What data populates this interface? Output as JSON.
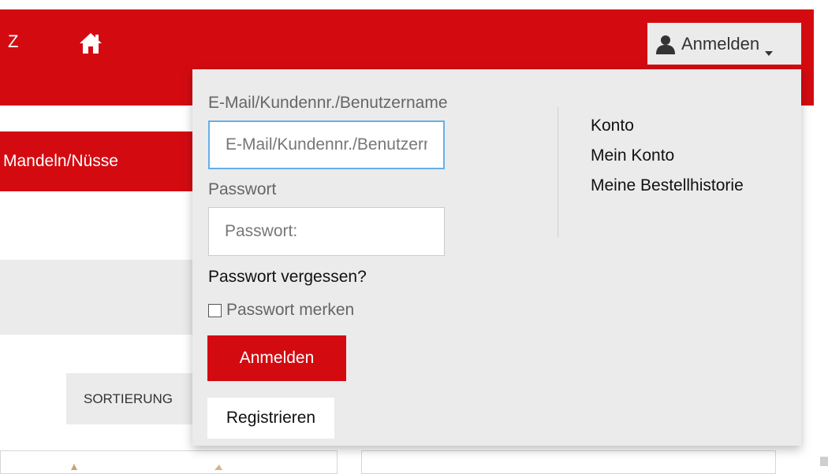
{
  "header": {
    "nav_partial": "Z",
    "home_icon": "home-icon",
    "login_button_label": "Anmelden",
    "user_icon": "user-icon",
    "brand_color": "#d30b11"
  },
  "category": {
    "active_label": "Mandeln/Nüsse"
  },
  "sort": {
    "label": "SORTIERUNG"
  },
  "login_dropdown": {
    "email_label": "E-Mail/Kundennr./Benutzername",
    "email_placeholder": "E-Mail/Kundennr./Benutzername",
    "password_label": "Passwort",
    "password_placeholder": "Passwort:",
    "forgot_link": "Passwort vergessen?",
    "remember_label": "Passwort merken",
    "remember_checked": false,
    "submit_label": "Anmelden",
    "register_label": "Registrieren"
  },
  "account_menu": {
    "heading": "Konto",
    "items": [
      "Mein Konto",
      "Meine Bestellhistorie"
    ]
  }
}
